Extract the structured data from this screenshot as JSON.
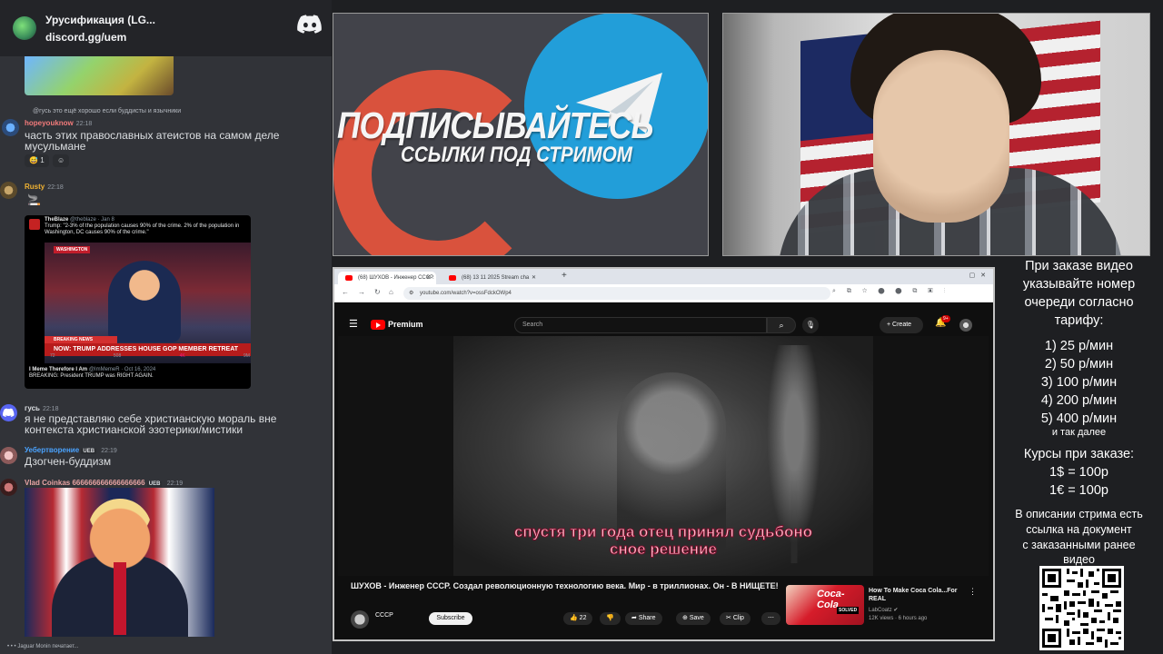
{
  "discord": {
    "server_name": "Урусификация (LG...",
    "invite": "discord.gg/uem",
    "messages": [
      {
        "reply_to": "@гусь это ещё хорошо если буддисты и язычники",
        "user": "hopeyouknow",
        "time": "22:18",
        "text": "часть этих православных атеистов на самом деле мусульмане",
        "reactions": [
          "1"
        ]
      },
      {
        "user": "Rusty",
        "time": "22:18",
        "embed": {
          "author": "TheBlaze",
          "handle": "@theblaze · Jan 8",
          "text": "Trump: \"2-3% of the population causes 90% of the crime. 2% of the population in Washington, DC causes 90% of the crime.\"",
          "banner_top": "WASHINGTON",
          "banner_news": "BREAKING NEWS",
          "banner": "NOW: TRUMP ADDRESSES HOUSE GOP MEMBER RETREAT",
          "stats": [
            "72",
            "508",
            "4K",
            "9M"
          ],
          "quote_author": "I Meme Therefore I Am",
          "quote_handle": "@ImMemeR · Oct 16, 2024",
          "quote_text": "BREAKING: President TRUMP was RIGHT AGAIN."
        }
      },
      {
        "user": "гусь",
        "time": "22:18",
        "text": "я не представляю себе христианскую мораль вне контекста христианской эзотерики/мистики"
      },
      {
        "user": "Уебертворение",
        "tag": "UEB",
        "time": "22:19",
        "text": "Дзогчен-буддизм"
      },
      {
        "user": "Vlad Coinkas 666666666666666666",
        "tag": "UEB",
        "time": "22:19"
      }
    ],
    "typing": "Jaguar Monin печатает..."
  },
  "promo": {
    "title": "ПОДПИСЫВАЙТЕСЬ",
    "subtitle": "ССЫЛКИ ПОД СТРИМОМ"
  },
  "browser": {
    "tabs": [
      {
        "label": "(68) ШУХОВ - Инженер СССР."
      },
      {
        "label": "(68) 13 11 2025 Stream cha"
      }
    ],
    "url": "youtube.com/watch?v=ossFdckOWp4"
  },
  "youtube": {
    "brand": "Premium",
    "search_placeholder": "Search",
    "create_label": "Create",
    "notifications": "9+",
    "subtitle_line1": "спустя три года отец принял судьбоно",
    "subtitle_line2": "сное решение",
    "video_title": "ШУХОВ - Инженер СССР. Создал революционную технологию века. Мир - в триллионах. Он - В НИЩЕТЕ!",
    "channel": "СССР",
    "subscribe_label": "Subscribe",
    "likes": "22",
    "share_label": "Share",
    "save_label": "Save",
    "clip_label": "Clip",
    "recommendation": {
      "title": "How To Make Coca Cola...For REAL",
      "channel": "LabCoatz",
      "meta": "12K views · 6 hours ago",
      "thumb_text": "Coca-Cola",
      "thumb_badge": "SOLVED"
    }
  },
  "info": {
    "order_1": "При заказе видео",
    "order_2": "указывайте номер",
    "order_3": "очереди согласно",
    "order_4": "тарифу:",
    "tariff_1": "1) 25 р/мин",
    "tariff_2": "2) 50 р/мин",
    "tariff_3": "3) 100 р/мин",
    "tariff_4": "4) 200 р/мин",
    "tariff_5": "5) 400 р/мин",
    "tariff_more": "и так далее",
    "rates_title": "Курсы при заказе:",
    "rate_usd": "1$ = 100р",
    "rate_eur": "1€ = 100р",
    "desc_1": "В описании стрима есть",
    "desc_2": "ссылка на документ",
    "desc_3": "с заказанными ранее",
    "desc_4": "видео"
  },
  "colors": {
    "discord_bg": "#313338",
    "youtube_red": "#ff0000",
    "telegram_blue": "#229ed9",
    "boosty_orange": "#e2533d",
    "subtitle_pink": "#ffb9c8"
  }
}
